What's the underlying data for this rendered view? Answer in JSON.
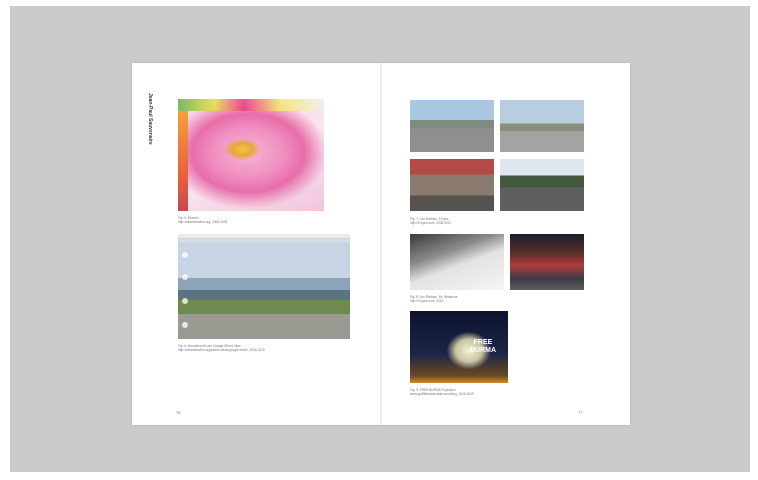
{
  "left_page": {
    "running_head": "Jean-Paul Sauvenaire",
    "fig1_caption_line1": "Fig. 5: Blumen",
    "fig1_caption_line2": "http://streetviewfun.org, 2008-2009",
    "fig2_caption_line1": "Fig. 6: Mounteverdi.com Google Street View",
    "fig2_caption_line2": "http://streetviewfun.org/street-views/google-earth/, 2008-2010",
    "page_number": "76"
  },
  "right_page": {
    "fig3_caption_line1": "Fig. 7: Jon Rafman, 9 Eyes",
    "fig3_caption_line2": "http://9-eyes.com, 2008-2011",
    "fig4_caption_line1": "Fig. 8: Jon Rafman, Mr. Whitmore",
    "fig4_caption_line2": "http://9-eyes.com, 2010",
    "fig5_caption_line1": "Fig. 9: FREE BURMA Projection",
    "fig5_caption_line2": "www.graffitiresearchlab.com/blog, 2008-2009",
    "free_burma_text": "FREE BURMA",
    "page_number": "77"
  }
}
